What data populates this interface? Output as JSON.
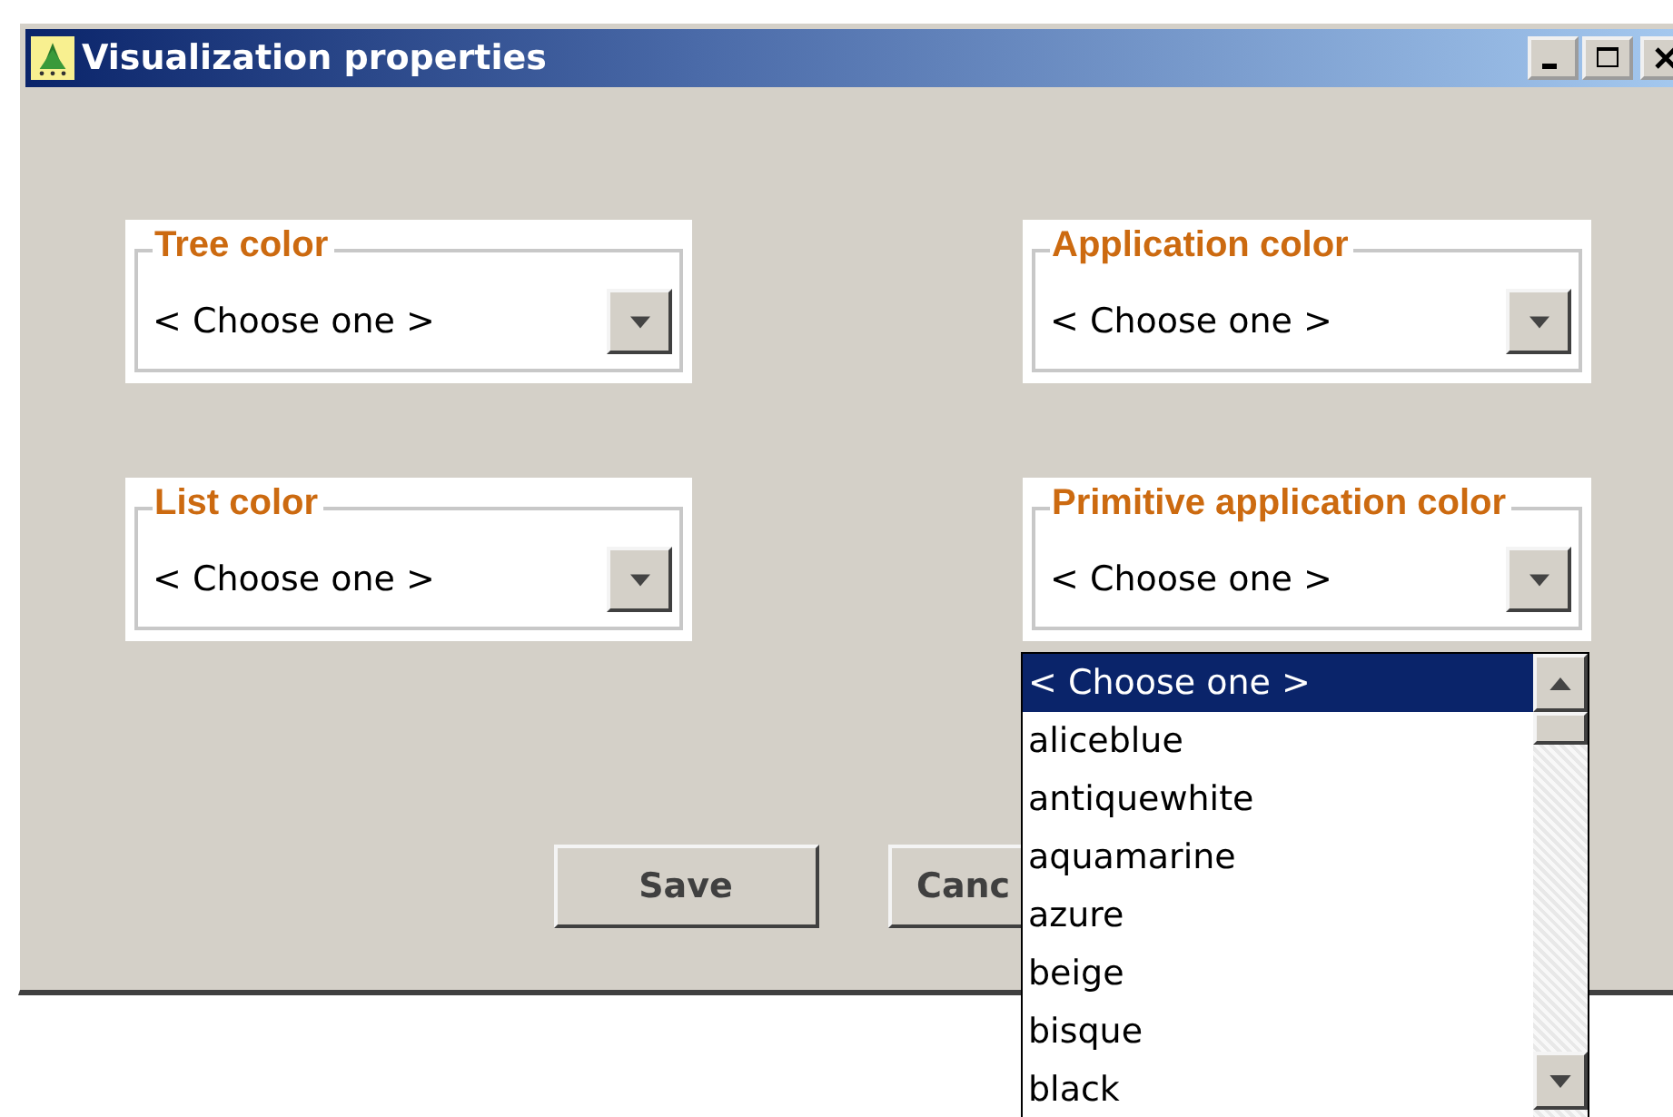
{
  "window": {
    "title": "Visualization properties"
  },
  "groups": [
    {
      "label": "Tree color",
      "value": "< Choose one >"
    },
    {
      "label": "Application color",
      "value": "< Choose one >"
    },
    {
      "label": "List color",
      "value": "< Choose one >"
    },
    {
      "label": "Primitive application color",
      "value": "< Choose one >"
    }
  ],
  "buttons": [
    "Save",
    "Canc"
  ],
  "dropdown_list": [
    {
      "label": "< Choose one >",
      "selected": true
    },
    {
      "label": "aliceblue",
      "selected": false
    },
    {
      "label": "antiquewhite",
      "selected": false
    },
    {
      "label": "aquamarine",
      "selected": false
    },
    {
      "label": "azure",
      "selected": false
    },
    {
      "label": "beige",
      "selected": false
    },
    {
      "label": "bisque",
      "selected": false
    },
    {
      "label": "black",
      "selected": false
    }
  ]
}
